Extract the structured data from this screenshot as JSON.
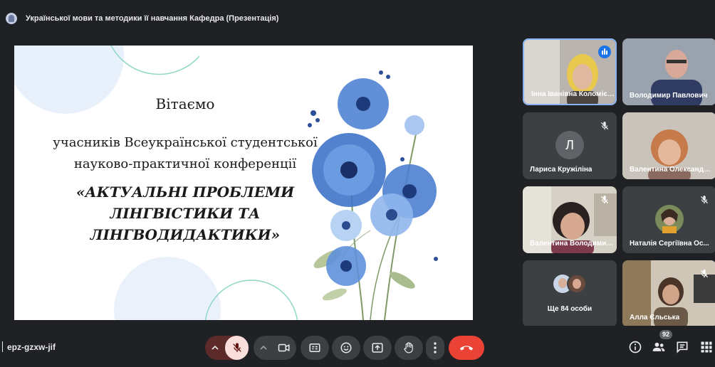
{
  "window": {
    "title": "Української мови та методики її навчання Кафедра (Презентація)"
  },
  "slide": {
    "greeting": "Вітаємо",
    "line1": "учасників Всеукраїнської студентської",
    "line2": "науково-практичної конференції",
    "conference_line1": "«АКТУАЛЬНІ ПРОБЛЕМИ",
    "conference_line2": "ЛІНГВІСТИКИ ТА",
    "conference_line3": "ЛІНГВОДИДАКТИКИ»"
  },
  "participants": [
    {
      "name": "Інна Іванівна Коломієць",
      "speaking": true
    },
    {
      "name": "Володимир Павлович",
      "muted": false
    },
    {
      "name": "Лариса Кружіліна",
      "initial": "Л",
      "muted": true
    },
    {
      "name": "Валентина Олександрівна",
      "muted": false
    },
    {
      "name": "Валентина Володимирівна",
      "muted": true
    },
    {
      "name": "Наталія Сергіївна Ос...",
      "muted": true
    },
    {
      "name": "Ще 84 особи"
    },
    {
      "name": "Алла Єльська",
      "muted": true
    }
  ],
  "bottom_bar": {
    "meeting_code": "epz-gzxw-jif",
    "participants_count": "92"
  },
  "colors": {
    "background": "#202124",
    "tile": "#3c4043",
    "active_border": "#8ab4f8",
    "hangup": "#ea4335",
    "mic_off_bg": "#f9dedc"
  },
  "icons": [
    "mic-off-icon",
    "camera-icon",
    "captions-icon",
    "emoji-icon",
    "present-icon",
    "raise-hand-icon",
    "more-options-icon",
    "hangup-icon",
    "info-icon",
    "people-icon",
    "chat-icon",
    "activities-icon",
    "chevron-up-icon"
  ]
}
